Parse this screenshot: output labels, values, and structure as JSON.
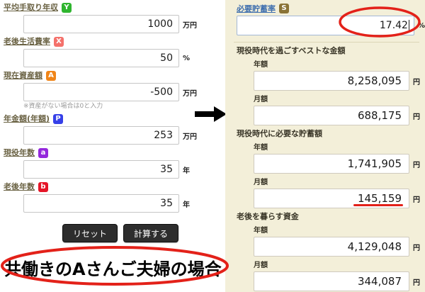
{
  "annotation_color": "#e32119",
  "left_form": {
    "fields": [
      {
        "label": "平均手取り年収",
        "badge": "Y",
        "badge_color": "#2fb52f",
        "value": "1000",
        "unit": "万円"
      },
      {
        "label": "老後生活費率",
        "badge": "X",
        "badge_color": "#f4716b",
        "value": "50",
        "unit": "%"
      },
      {
        "label": "現在資産額",
        "badge": "A",
        "badge_color": "#f08518",
        "value": "-500",
        "unit": "万円",
        "note": "※資産がない場合は0と入力"
      },
      {
        "label": "年金額(年額)",
        "badge": "P",
        "badge_color": "#3640e8",
        "value": "253",
        "unit": "万円"
      },
      {
        "label": "現役年数",
        "badge": "a",
        "badge_color": "#9428dc",
        "value": "35",
        "unit": "年"
      },
      {
        "label": "老後年数",
        "badge": "b",
        "badge_color": "#e51527",
        "value": "35",
        "unit": "年"
      }
    ],
    "reset_button": "リセット",
    "calc_button": "計算する",
    "caption": "共働きのAさんご夫婦の場合"
  },
  "result_panel": {
    "rate_label": "必要貯蓄率",
    "rate_badge": "S",
    "rate_badge_color": "#8a7336",
    "rate_value": "17.42",
    "rate_unit": "%",
    "sections": [
      {
        "title": "現役時代を過ごすベストな金額",
        "rows": [
          {
            "label": "年額",
            "value": "8,258,095",
            "unit": "円"
          },
          {
            "label": "月額",
            "value": "688,175",
            "unit": "円"
          }
        ]
      },
      {
        "title": "現役時代に必要な貯蓄額",
        "rows": [
          {
            "label": "年額",
            "value": "1,741,905",
            "unit": "円"
          },
          {
            "label": "月額",
            "value": "145,159",
            "unit": "円"
          }
        ]
      },
      {
        "title": "老後を暮らす資金",
        "rows": [
          {
            "label": "年額",
            "value": "4,129,048",
            "unit": "円"
          },
          {
            "label": "月額",
            "value": "344,087",
            "unit": "円"
          }
        ]
      }
    ]
  }
}
